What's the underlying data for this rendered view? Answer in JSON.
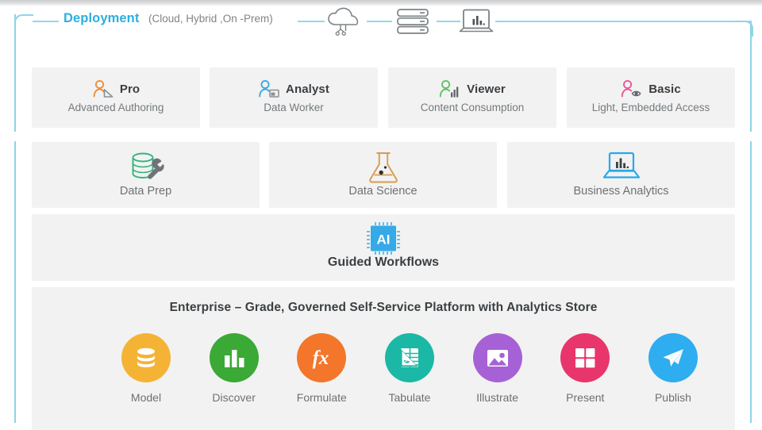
{
  "header": {
    "label": "Deployment",
    "sub": "(Cloud, Hybrid ,On -Prem)",
    "icons": [
      "cloud-icon",
      "server-rack-icon",
      "laptop-analytics-icon"
    ],
    "label_color": "#2ab0e0",
    "line_color": "#93d8ec"
  },
  "personas": [
    {
      "title": "Pro",
      "sub": "Advanced Authoring",
      "icon": "person-ruler-icon",
      "color": "#ef8d3d"
    },
    {
      "title": "Analyst",
      "sub": "Data Worker",
      "icon": "person-window-icon",
      "color": "#3fa9dd"
    },
    {
      "title": "Viewer",
      "sub": "Content Consumption",
      "icon": "person-chart-icon",
      "color": "#63c264"
    },
    {
      "title": "Basic",
      "sub": "Light, Embedded Access",
      "icon": "person-eye-icon",
      "color": "#e8589b"
    }
  ],
  "domains": [
    {
      "label": "Data Prep",
      "icon": "database-wrench-icon",
      "color": "#36b37e"
    },
    {
      "label": "Data Science",
      "icon": "flask-icon",
      "color": "#d99b50"
    },
    {
      "label": "Business Analytics",
      "icon": "laptop-chart-icon",
      "color": "#2aa8e8"
    }
  ],
  "ai": {
    "chip_text": "AI",
    "label": "Guided Workflows",
    "color": "#36a9e8"
  },
  "platform": {
    "title": "Enterprise – Grade,  Governed Self-Service Platform with Analytics Store",
    "items": [
      {
        "label": "Model",
        "icon": "database-icon",
        "color": "#f5b335"
      },
      {
        "label": "Discover",
        "icon": "bar-chart-icon",
        "color": "#3aa935"
      },
      {
        "label": "Formulate",
        "icon": "fx-icon",
        "color": "#f3762a"
      },
      {
        "label": "Tabulate",
        "icon": "table-ruler-icon",
        "color": "#1bb8a6"
      },
      {
        "label": "Illustrate",
        "icon": "image-icon",
        "color": "#a761d6"
      },
      {
        "label": "Present",
        "icon": "grid-icon",
        "color": "#e8356b"
      },
      {
        "label": "Publish",
        "icon": "paper-plane-icon",
        "color": "#2eadf0"
      }
    ]
  }
}
